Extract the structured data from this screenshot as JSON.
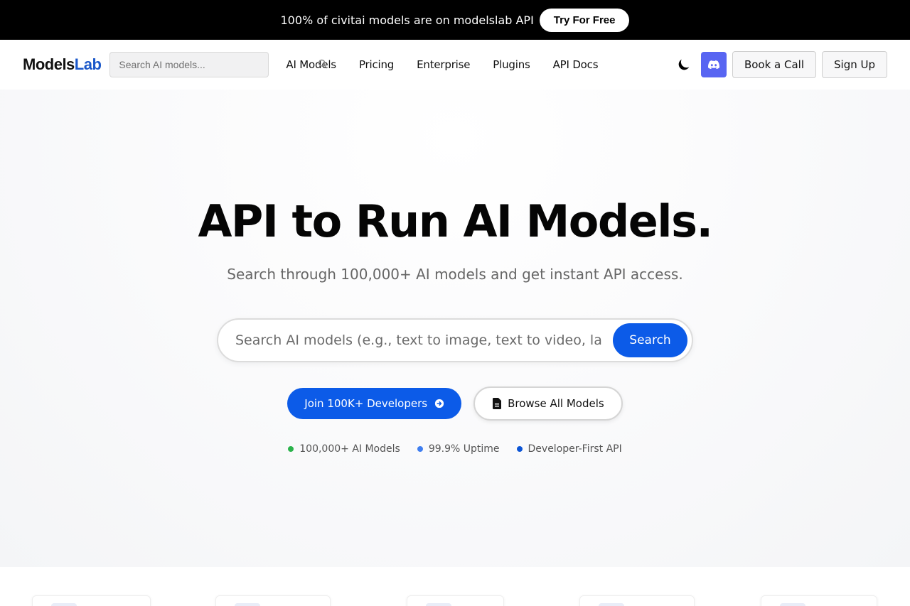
{
  "promo": {
    "text": "100% of civitai models are on modelslab API",
    "button": "Try For Free"
  },
  "header": {
    "logo_main": "Models",
    "logo_accent": "Lab",
    "search_placeholder": "Search AI models...",
    "nav": [
      {
        "label": "AI Models"
      },
      {
        "label": "Pricing"
      },
      {
        "label": "Enterprise"
      },
      {
        "label": "Plugins"
      },
      {
        "label": "API Docs"
      }
    ],
    "icons": {
      "theme": "moon-icon",
      "community": "discord-icon",
      "nav_search": "search-icon"
    },
    "book_call": "Book a Call",
    "sign_up": "Sign Up"
  },
  "hero": {
    "title": "API to Run AI Models.",
    "subtitle": "Search through 100,000+ AI models and get instant API access.",
    "search_placeholder": "Search AI models (e.g., text to image, text to video, language models...)",
    "search_button": "Search",
    "cta_primary": "Join 100K+ Developers",
    "cta_secondary": "Browse All Models",
    "stats": [
      {
        "label": "100,000+ AI Models",
        "color": "#2bb34b"
      },
      {
        "label": "99.9% Uptime",
        "color": "#3f7ef0"
      },
      {
        "label": "Developer-First API",
        "color": "#0c55d6"
      }
    ]
  },
  "colors": {
    "accent": "#0c5be8",
    "logo_accent": "#1a57c9",
    "discord": "#5865f2",
    "promo_bg": "#000000"
  }
}
